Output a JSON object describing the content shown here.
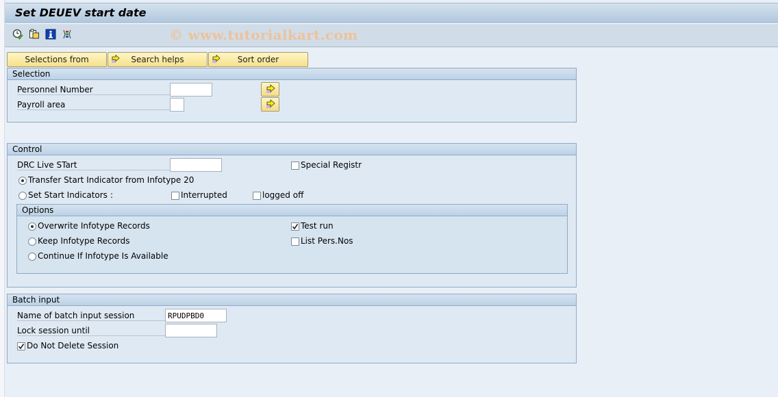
{
  "window": {
    "title": "Set DEUEV start date"
  },
  "toolbar": {
    "icons": [
      "execute-clock-icon",
      "copy-variant-icon",
      "info-icon",
      "columns-icon"
    ],
    "watermark": "© www.tutorialkart.com"
  },
  "buttons": {
    "selections_from": "Selections from",
    "search_helps": "Search helps",
    "sort_order": "Sort order"
  },
  "selection": {
    "header": "Selection",
    "personnel_number": {
      "label": "Personnel Number",
      "value": ""
    },
    "payroll_area": {
      "label": "Payroll area",
      "value": ""
    }
  },
  "control": {
    "header": "Control",
    "drc_live_start": {
      "label": "DRC Live STart",
      "value": ""
    },
    "special_registr": {
      "label": "Special Registr",
      "checked": false
    },
    "transfer_start": {
      "label": "Transfer Start Indicator from Infotype 20",
      "selected": true
    },
    "set_start": {
      "label": "Set Start Indicators",
      "colon": ":",
      "selected": false
    },
    "interrupted": {
      "label": "Interrupted",
      "checked": false
    },
    "logged_off": {
      "label": "logged off",
      "checked": false
    },
    "options": {
      "header": "Options",
      "overwrite": {
        "label": "Overwrite Infotype Records",
        "selected": true
      },
      "keep": {
        "label": "Keep Infotype Records",
        "selected": false
      },
      "continue": {
        "label": "Continue If Infotype Is Available",
        "selected": false
      },
      "test_run": {
        "label": "Test run",
        "checked": true
      },
      "list_pers": {
        "label": "List Pers.Nos",
        "checked": false
      }
    }
  },
  "batch": {
    "header": "Batch input",
    "session_name": {
      "label": "Name of batch input session",
      "value": "RPUDPBD0"
    },
    "lock_until": {
      "label": "Lock session until",
      "value": ""
    },
    "do_not_delete": {
      "label": "Do Not Delete Session",
      "checked": true
    }
  }
}
